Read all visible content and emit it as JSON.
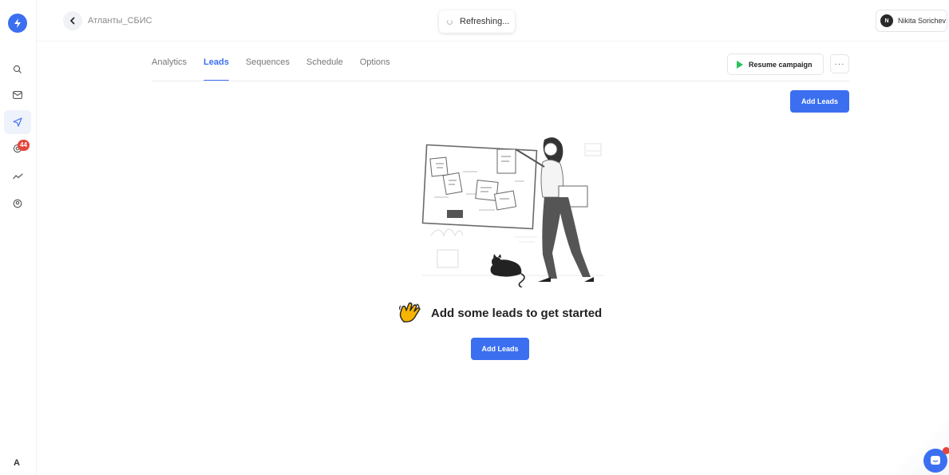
{
  "topbar": {
    "breadcrumb": "Атланты_СБИС",
    "refresh_status": "Refreshing...",
    "user": {
      "initial": "N",
      "name": "Nikita Sorichev"
    }
  },
  "sidebar": {
    "badge_count": "44",
    "items": [
      {
        "icon": "search-icon"
      },
      {
        "icon": "mail-icon"
      },
      {
        "icon": "send-icon",
        "active": true
      },
      {
        "icon": "inbox-icon"
      },
      {
        "icon": "analytics-icon"
      },
      {
        "icon": "user-circle-icon"
      }
    ]
  },
  "tabs": [
    {
      "label": "Analytics",
      "active": false
    },
    {
      "label": "Leads",
      "active": true
    },
    {
      "label": "Sequences",
      "active": false
    },
    {
      "label": "Schedule",
      "active": false
    },
    {
      "label": "Options",
      "active": false
    }
  ],
  "actions": {
    "resume_label": "Resume campaign",
    "more_label": "···",
    "add_leads_top": "Add Leads"
  },
  "empty_state": {
    "message": "Add some leads to get started",
    "button_label": "Add Leads"
  },
  "footer": {
    "rail_letter": "A"
  },
  "colors": {
    "accent": "#3b6ff0",
    "play": "#2bbf5d",
    "badge": "#e6453b"
  }
}
